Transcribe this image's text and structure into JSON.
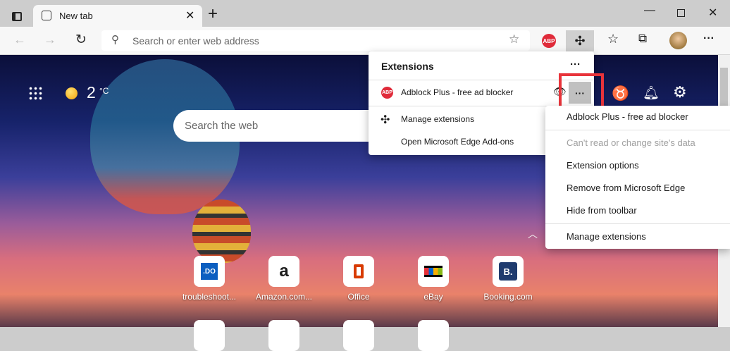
{
  "tab": {
    "title": "New tab"
  },
  "address": {
    "placeholder": "Search or enter web address"
  },
  "page": {
    "temperature": "2",
    "temp_unit": "°C",
    "search_placeholder": "Search the web"
  },
  "extensions_panel": {
    "title": "Extensions",
    "extension_name": "Adblock Plus - free ad blocker",
    "manage": "Manage extensions",
    "addons": "Open Microsoft Edge Add-ons",
    "more": "···"
  },
  "context_menu": {
    "items": [
      "Adblock Plus - free ad blocker",
      "Can't read or change site's data",
      "Extension options",
      "Remove from Microsoft Edge",
      "Hide from toolbar",
      "Manage extensions"
    ]
  },
  "tiles": [
    {
      "label": "troubleshoot...",
      "icon": ".DO"
    },
    {
      "label": "Amazon.com...",
      "icon": "a"
    },
    {
      "label": "Office",
      "icon": "O"
    },
    {
      "label": "eBay",
      "icon": "bag"
    },
    {
      "label": "Booking.com",
      "icon": "B."
    }
  ],
  "abp_badge": "ABP",
  "colors": {
    "highlight": "#e8343b",
    "abp": "#e02b3a"
  }
}
